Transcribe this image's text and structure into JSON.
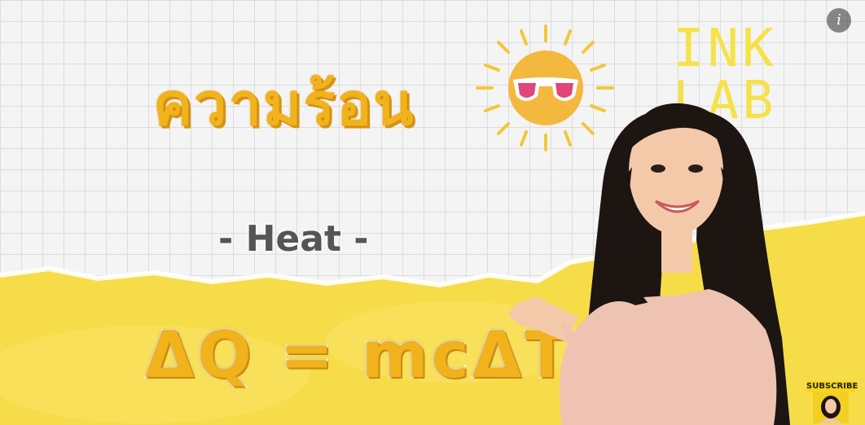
{
  "video": {
    "thai_title": "ความร้อน",
    "subtitle": "- Heat -",
    "formula": "ΔQ = mcΔT",
    "brand": "INK LAB",
    "subscribe_label": "SUBSCRIBE"
  },
  "icons": {
    "info": "info-icon",
    "sun": "sun-with-sunglasses-icon"
  },
  "colors": {
    "accent_yellow": "#f1b21c",
    "band_yellow": "#f7dc4a",
    "brand_yellow": "#f5e24a",
    "grid_paper": "#f4f4f4",
    "sunglasses_pink": "#e0457b"
  }
}
